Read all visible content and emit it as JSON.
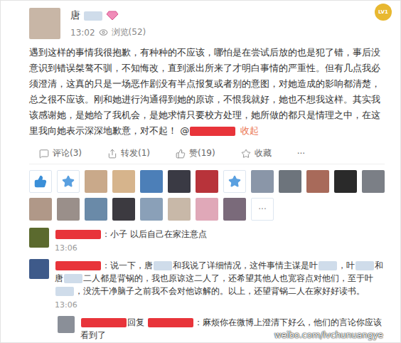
{
  "post": {
    "author": [
      {
        "kind": "text",
        "text": "唐"
      },
      {
        "kind": "blur"
      }
    ],
    "level_badge": "LV1",
    "time": "13:02",
    "views": "浏览(52)",
    "body": [
      {
        "kind": "text",
        "text": "遇到这样的事情我很抱歉，有种种的不应该，哪怕是在尝试后放的也是犯了错，事后没意识到错误桀骜不驯，不知悔改，直到派出所来了才明白事情的严重性。但有几点我必须澄清，这真的只是一场恶作剧没有半点报复或者别的意图，对她造成的影响都清楚，总之很不应该。刚和她进行沟通得到她的原谅，不恨我就好，她也不想我这样。其实我该感谢她，是她给了我机会，是她求情只要校方处理，她所做的都只是情理之中，在这里我向她表示深深地歉意，对不起！ @"
      },
      {
        "kind": "redacted"
      }
    ],
    "collapse": "收起"
  },
  "actions": [
    {
      "label": "评论(3)",
      "kind": "comment"
    },
    {
      "label": "转发(1)",
      "kind": "share"
    },
    {
      "label": "赞(19)",
      "kind": "like"
    },
    {
      "label": "收藏",
      "kind": "favorite"
    },
    {
      "label": "···",
      "kind": "more"
    }
  ],
  "likers": [
    {
      "kind": "like",
      "color": "#3b8fd8"
    },
    {
      "kind": "star",
      "color": "#5aa0e0"
    },
    {
      "kind": "avatar",
      "color": "#c9a98a"
    },
    {
      "kind": "avatar",
      "color": "#d6b48c"
    },
    {
      "kind": "avatar",
      "color": "#4c7fb8"
    },
    {
      "kind": "avatar",
      "color": "#3a3a44"
    },
    {
      "kind": "avatar",
      "color": "#b8333a"
    },
    {
      "kind": "star",
      "color": "#5aa0e0"
    },
    {
      "kind": "avatar",
      "color": "#8a96a8"
    },
    {
      "kind": "avatar",
      "color": "#6d747c"
    },
    {
      "kind": "avatar",
      "color": "#a86a5a"
    },
    {
      "kind": "avatar",
      "color": "#2a2a2a"
    },
    {
      "kind": "avatar",
      "color": "#7b7f86"
    },
    {
      "kind": "avatar",
      "color": "#b09888"
    },
    {
      "kind": "avatar",
      "color": "#9a8f8a"
    },
    {
      "kind": "avatar",
      "color": "#6a8aa8"
    },
    {
      "kind": "avatar",
      "color": "#3c3a40"
    },
    {
      "kind": "avatar",
      "color": "#8aa0b8"
    },
    {
      "kind": "avatar",
      "color": "#c8b8a8"
    },
    {
      "kind": "avatar",
      "color": "#e0a8b8"
    },
    {
      "kind": "avatar",
      "color": "#7a6a7a"
    }
  ],
  "more_likers": "···",
  "comments": [
    {
      "kind": "comment",
      "avatar_color": "#5b6a2e",
      "content": [
        {
          "kind": "redacted"
        },
        {
          "kind": "text",
          "text": "：小子 以后自己在家注意点"
        }
      ],
      "time": "13:06"
    },
    {
      "kind": "comment",
      "avatar_color": "#3e5a8a",
      "content": [
        {
          "kind": "redacted"
        },
        {
          "kind": "text",
          "text": "：说一下，唐"
        },
        {
          "kind": "blur"
        },
        {
          "kind": "text",
          "text": "和我说了详细情况，这件事情主谋是叶"
        },
        {
          "kind": "blur"
        },
        {
          "kind": "text",
          "text": "，叶"
        },
        {
          "kind": "blur"
        },
        {
          "kind": "text",
          "text": "和唐"
        },
        {
          "kind": "blur"
        },
        {
          "kind": "text",
          "text": "二人都是背锅的，我也原谅这二人了，还希望其他人也宽容点对他们，至于叶"
        },
        {
          "kind": "blur"
        },
        {
          "kind": "text",
          "text": "，没洗干净脑子之前我不会对他谅解的。以上，还望背锅二人在家好好读书。"
        }
      ],
      "time": "13:06"
    },
    {
      "kind": "reply",
      "avatar_color": "#8a8f98",
      "content": [
        {
          "kind": "redacted"
        },
        {
          "kind": "text",
          "text": "回复 "
        },
        {
          "kind": "redacted"
        },
        {
          "kind": "text",
          "text": "：麻烦你在微博上澄清下好么，他们的言论你应该看到了"
        }
      ],
      "time": ""
    }
  ],
  "watermark": "weibo.com/lvchunuangye"
}
